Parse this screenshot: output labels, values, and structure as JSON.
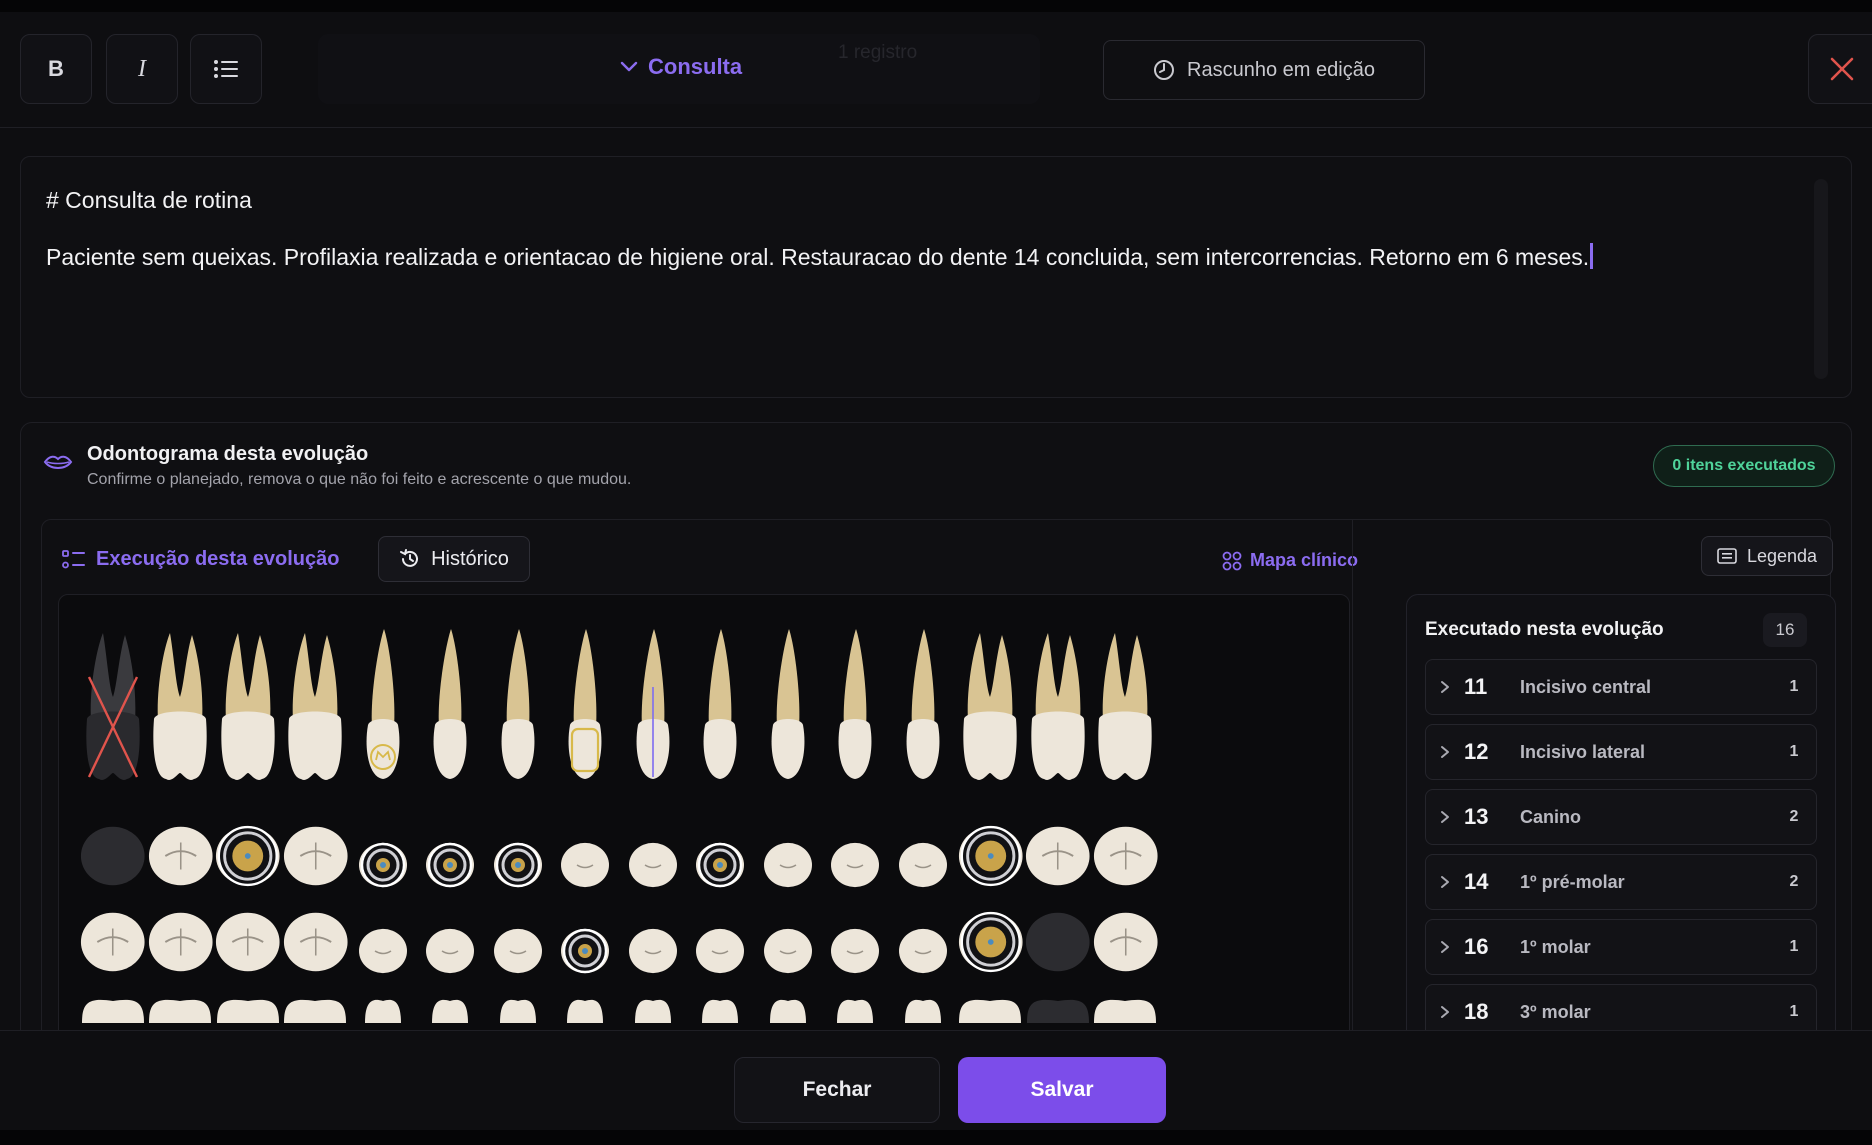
{
  "toolbar": {
    "bold_label": "B",
    "italic_label": "I",
    "section_label": "Consulta",
    "ghost_count": "1 registro",
    "draft_status": "Rascunho em edição"
  },
  "editor": {
    "title": "# Consulta de rotina",
    "body": "Paciente sem queixas. Profilaxia realizada e orientacao de higiene oral. Restauracao do dente 14 concluida, sem intercorrencias. Retorno em 6 meses."
  },
  "odontograma": {
    "title": "Odontograma desta evolução",
    "subtitle": "Confirme o planejado, remova o que não foi feito e acrescente o que mudou.",
    "badge": "0 itens executados",
    "tab_exec": "Execução desta evolução",
    "tab_history": "Histórico",
    "clinical_map": "Mapa clínico",
    "legend": "Legenda"
  },
  "executed": {
    "title": "Executado nesta evolução",
    "count": "16",
    "items": [
      {
        "num": "11",
        "name": "Incisivo central",
        "count": "1"
      },
      {
        "num": "12",
        "name": "Incisivo lateral",
        "count": "1"
      },
      {
        "num": "13",
        "name": "Canino",
        "count": "2"
      },
      {
        "num": "14",
        "name": "1º pré-molar",
        "count": "2"
      },
      {
        "num": "16",
        "name": "1º molar",
        "count": "1"
      },
      {
        "num": "18",
        "name": "3º molar",
        "count": "1"
      }
    ]
  },
  "footer": {
    "close_label": "Fechar",
    "save_label": "Salvar"
  },
  "colors": {
    "accent": "#7c4dea",
    "accent_text": "#8b6cf0",
    "success": "#4fd39a",
    "danger": "#e0544c",
    "enamel": "#ede6da",
    "root": "#d9c493"
  },
  "teeth_upper_status": [
    "missing",
    "normal",
    "normal",
    "normal",
    "crown",
    "normal",
    "normal",
    "restoration",
    "implant",
    "normal",
    "normal",
    "normal",
    "normal",
    "normal",
    "normal",
    "normal"
  ],
  "occlusal_row1_status": [
    "missing",
    "normal",
    "ring",
    "normal",
    "ring",
    "ring",
    "ring",
    "normal",
    "normal",
    "ring",
    "normal",
    "normal",
    "normal",
    "ring",
    "normal",
    "normal"
  ],
  "occlusal_row2_status": [
    "normal",
    "normal",
    "normal",
    "normal",
    "normal",
    "normal",
    "normal",
    "ring",
    "normal",
    "normal",
    "normal",
    "normal",
    "normal",
    "ring",
    "dark",
    "normal"
  ]
}
